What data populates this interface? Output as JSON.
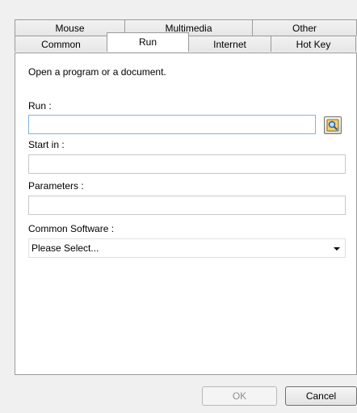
{
  "tabs": {
    "row1": [
      "Mouse",
      "Multimedia",
      "Other"
    ],
    "row2": [
      "Common",
      "Run",
      "Internet",
      "Hot Key"
    ],
    "active": "Run"
  },
  "panel": {
    "description": "Open a program or a document.",
    "run": {
      "label": "Run :",
      "value": ""
    },
    "browse_icon": "browse-folder-icon",
    "start_in": {
      "label": "Start in :",
      "value": ""
    },
    "parameters": {
      "label": "Parameters :",
      "value": ""
    },
    "common_software": {
      "label": "Common Software :",
      "selected": "Please Select..."
    }
  },
  "buttons": {
    "ok": "OK",
    "cancel": "Cancel"
  }
}
